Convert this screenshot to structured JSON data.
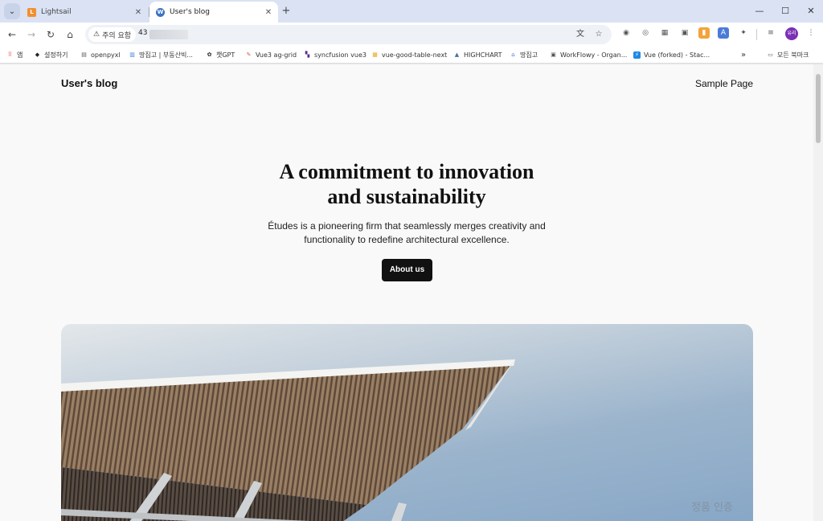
{
  "browser": {
    "tabs": [
      {
        "title": "Lightsail",
        "favicon": "lightsail-icon",
        "active": false
      },
      {
        "title": "User's blog",
        "favicon": "wordpress-icon",
        "active": true
      }
    ],
    "address": {
      "security_label": "주의 요함",
      "url_prefix": "43"
    },
    "bookmarks": [
      {
        "label": "앱"
      },
      {
        "label": "설정하기"
      },
      {
        "label": "openpyxl"
      },
      {
        "label": "땅집고 | 부동산빅..."
      },
      {
        "label": "챗GPT"
      },
      {
        "label": "Vue3 ag-grid"
      },
      {
        "label": "syncfusion vue3"
      },
      {
        "label": "vue-good-table-next"
      },
      {
        "label": "HIGHCHART"
      },
      {
        "label": "땅집고"
      },
      {
        "label": "WorkFlowy - Organ..."
      },
      {
        "label": "Vue (forked) - Stac..."
      }
    ],
    "all_bookmarks_label": "모든 북마크",
    "profile_initials": "유리"
  },
  "site": {
    "title": "User's blog",
    "nav_item": "Sample Page"
  },
  "hero": {
    "heading_line1": "A commitment to innovation",
    "heading_line2": "and sustainability",
    "text_line1": "Études is a pioneering firm that seamlessly merges creativity and",
    "text_line2": "functionality to redefine architectural excellence.",
    "button_label": "About us"
  },
  "overlay": {
    "watermark": "정품 인증"
  },
  "colors": {
    "page_bg": "#f9f9f9",
    "button_bg": "#111111",
    "tabstrip_bg": "#dae2f3"
  }
}
